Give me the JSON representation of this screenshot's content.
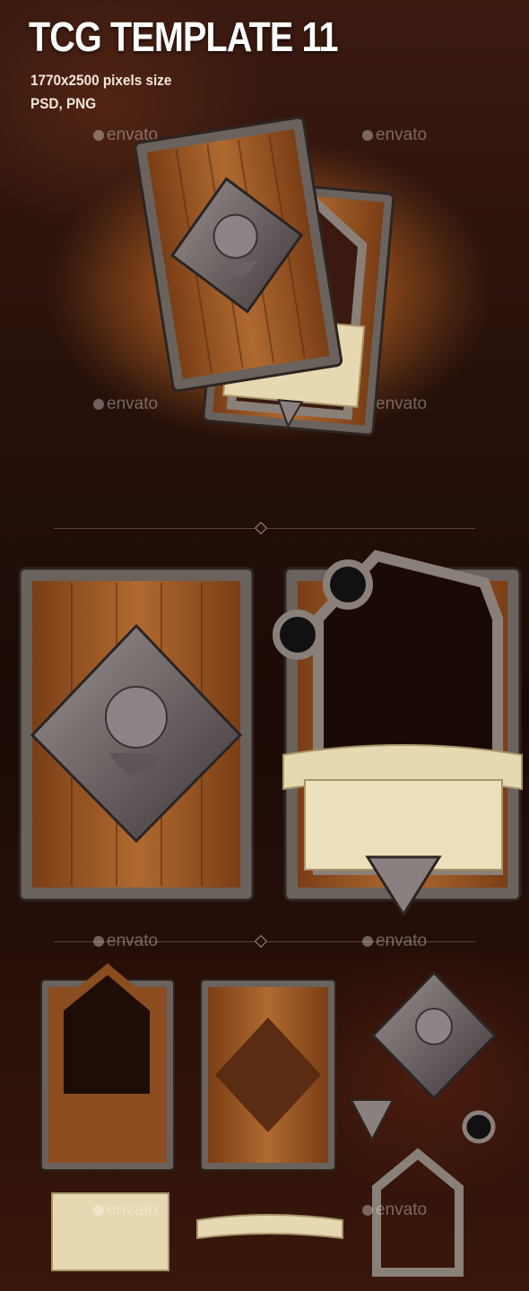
{
  "header": {
    "title": "TCG TEMPLATE 11",
    "size_line": "1770x2500  pixels size",
    "formats_line": "PSD, PNG"
  },
  "watermark": {
    "text": "envato",
    "icon": "envato-leaf-icon"
  },
  "colors": {
    "background": "#1e0c07",
    "wood": "#9a5a26",
    "wood_dark": "#5c3014",
    "metal": "#6e6560",
    "parchment": "#e6d8b0",
    "glow": "#e07a28"
  }
}
